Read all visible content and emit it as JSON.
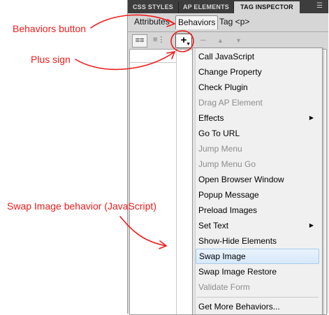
{
  "panel": {
    "tabs": [
      {
        "label": "CSS STYLES",
        "active": false
      },
      {
        "label": "AP ELEMENTS",
        "active": false
      },
      {
        "label": "TAG INSPECTOR",
        "active": true
      }
    ],
    "subtabs": {
      "attributes": "Attributes",
      "behaviors": "Behaviors",
      "tag": "Tag <p>"
    },
    "toolbar": {
      "show_set_events_icon": "show-set-events-icon",
      "show_all_events_icon": "show-all-events-icon",
      "add_behavior_icon": "plus-icon",
      "remove_icon": "minus-icon",
      "move_up_icon": "triangle-up-icon",
      "move_down_icon": "triangle-down-icon"
    }
  },
  "menu": {
    "items": [
      {
        "label": "Call JavaScript",
        "enabled": true,
        "submenu": false
      },
      {
        "label": "Change Property",
        "enabled": true,
        "submenu": false
      },
      {
        "label": "Check Plugin",
        "enabled": true,
        "submenu": false
      },
      {
        "label": "Drag AP Element",
        "enabled": false,
        "submenu": false
      },
      {
        "label": "Effects",
        "enabled": true,
        "submenu": true
      },
      {
        "label": "Go To URL",
        "enabled": true,
        "submenu": false
      },
      {
        "label": "Jump Menu",
        "enabled": false,
        "submenu": false
      },
      {
        "label": "Jump Menu Go",
        "enabled": false,
        "submenu": false
      },
      {
        "label": "Open Browser Window",
        "enabled": true,
        "submenu": false
      },
      {
        "label": "Popup Message",
        "enabled": true,
        "submenu": false
      },
      {
        "label": "Preload Images",
        "enabled": true,
        "submenu": false
      },
      {
        "label": "Set Text",
        "enabled": true,
        "submenu": true
      },
      {
        "label": "Show-Hide Elements",
        "enabled": true,
        "submenu": false
      },
      {
        "label": "Swap Image",
        "enabled": true,
        "submenu": false,
        "highlighted": true
      },
      {
        "label": "Swap Image Restore",
        "enabled": true,
        "submenu": false
      },
      {
        "label": "Validate Form",
        "enabled": false,
        "submenu": false
      }
    ],
    "footer_item": "Get More Behaviors..."
  },
  "annotations": {
    "behaviors_button": "Behaviors button",
    "plus_sign": "Plus sign",
    "swap_image": "Swap Image behavior (JavaScript)"
  },
  "colors": {
    "annotation": "#ee1c1c",
    "highlight_bg": "#d6e8fa",
    "disabled_text": "#8d8d8d",
    "tabbar_bg": "#3d3d3d"
  }
}
